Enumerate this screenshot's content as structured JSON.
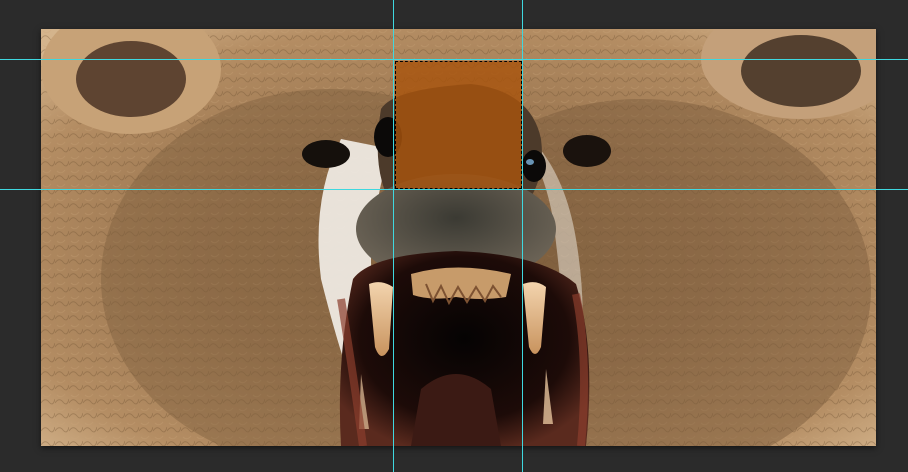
{
  "app": {
    "workspace_color": "#2b2b2b",
    "guide_color": "#3fd8df",
    "selection_fill": "#a8540e"
  },
  "canvas": {
    "subject": "bear-face-photo"
  },
  "selection": {
    "marquee": "dashed-rectangle"
  },
  "guides": {
    "vertical_count": 2,
    "horizontal_count": 2
  }
}
